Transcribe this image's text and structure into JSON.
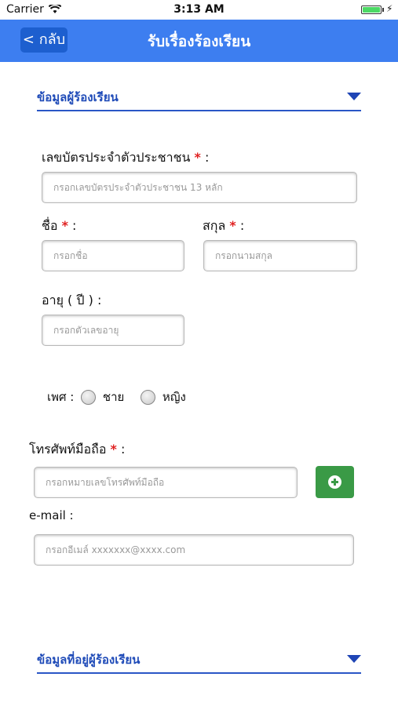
{
  "status_bar": {
    "carrier": "Carrier",
    "time": "3:13 AM"
  },
  "nav": {
    "back_label": "< กลับ",
    "title": "รับเรื่องร้องเรียน"
  },
  "section1": {
    "title": "ข้อมูลผู้ร้องเรียน"
  },
  "fields": {
    "id_card": {
      "label": "เลขบัตรประจำตัวประชาชน",
      "required": "*",
      "colon": ":",
      "placeholder": "กรอกเลขบัตรประจำตัวประชาชน 13 หลัก"
    },
    "first_name": {
      "label": "ชื่อ",
      "required": "*",
      "colon": ":",
      "placeholder": "กรอกชื่อ"
    },
    "last_name": {
      "label": "สกุล",
      "required": "*",
      "colon": ":",
      "placeholder": "กรอกนามสกุล"
    },
    "age": {
      "label": "อายุ ( ปี ) :",
      "placeholder": "กรอกตัวเลขอายุ"
    },
    "gender": {
      "label": "เพศ :",
      "options": [
        "ชาย",
        "หญิง"
      ]
    },
    "phone": {
      "label": "โทรศัพท์มือถือ",
      "required": "*",
      "colon": ":",
      "placeholder": "กรอกหมายเลขโทรศัพท์มือถือ"
    },
    "email": {
      "label": "e-mail :",
      "placeholder": "กรอกอีเมล์ xxxxxxx@xxxx.com"
    }
  },
  "section2": {
    "title": "ข้อมูลที่อยู่ผู้ร้องเรียน"
  },
  "colors": {
    "nav": "#3d7ef0",
    "accent": "#1f4bb8",
    "add_button": "#3a9a46",
    "required": "#e02020"
  },
  "icons": {
    "wifi": "wifi-icon",
    "battery": "battery-icon",
    "add": "plus-circle-icon",
    "expand": "triangle-down-icon"
  }
}
